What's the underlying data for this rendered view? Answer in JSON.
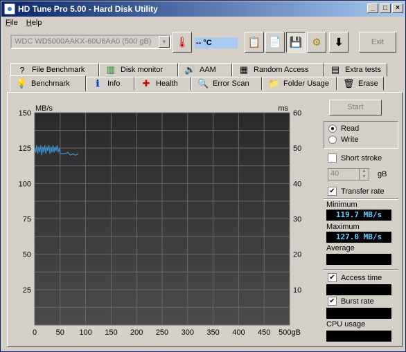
{
  "window": {
    "title": "HD Tune Pro 5.00 - Hard Disk Utility",
    "min": "_",
    "max": "□",
    "close": "×"
  },
  "menu": {
    "file": "File",
    "help": "Help"
  },
  "toolbar": {
    "drive": "WDC WD5000AAKX-60U6AA0 (500 gB)",
    "temperature": "-- °C",
    "exit": "Exit"
  },
  "tabs_top": [
    {
      "label": "File Benchmark",
      "icon": "?"
    },
    {
      "label": "Disk monitor",
      "icon": "▥"
    },
    {
      "label": "AAM",
      "icon": "🔊"
    },
    {
      "label": "Random Access",
      "icon": "▦"
    },
    {
      "label": "Extra tests",
      "icon": "▤"
    }
  ],
  "tabs_bottom": [
    {
      "label": "Benchmark",
      "icon": "💡"
    },
    {
      "label": "Info",
      "icon": "ℹ"
    },
    {
      "label": "Health",
      "icon": "✚"
    },
    {
      "label": "Error Scan",
      "icon": "🔍"
    },
    {
      "label": "Folder Usage",
      "icon": "📁"
    },
    {
      "label": "Erase",
      "icon": "🗑"
    }
  ],
  "right": {
    "start": "Start",
    "read": "Read",
    "write": "Write",
    "short_stroke": "Short stroke",
    "stroke_value": "40",
    "gb": "gB",
    "transfer_rate": "Transfer rate",
    "minimum_label": "Minimum",
    "minimum_value": "119.7 MB/s",
    "maximum_label": "Maximum",
    "maximum_value": "127.0 MB/s",
    "average_label": "Average",
    "average_value": "",
    "access_time": "Access time",
    "access_value": "",
    "burst_rate": "Burst rate",
    "burst_value": "",
    "cpu_usage": "CPU usage",
    "cpu_value": ""
  },
  "chart_data": {
    "type": "line",
    "ylabel": "MB/s",
    "y2label": "ms",
    "ylim": [
      0,
      150
    ],
    "y2lim": [
      0,
      60
    ],
    "xlim": [
      0,
      500
    ],
    "x_ticks": [
      "0",
      "50",
      "100",
      "150",
      "200",
      "250",
      "300",
      "350",
      "400",
      "450",
      "500gB"
    ],
    "y_ticks": [
      "25",
      "50",
      "75",
      "100",
      "125",
      "150"
    ],
    "y2_ticks": [
      "10",
      "20",
      "30",
      "40",
      "50",
      "60"
    ],
    "grid": true,
    "series": [
      {
        "color": "#3a8fd0",
        "x": [
          0,
          2,
          4,
          6,
          8,
          10,
          12,
          14,
          16,
          18,
          20,
          22,
          24,
          26,
          28,
          30,
          32,
          34,
          36,
          38,
          40,
          42,
          44,
          46,
          48,
          50,
          55,
          60,
          65,
          70,
          75,
          80,
          85
        ],
        "y": [
          125,
          122,
          127,
          121,
          126,
          122,
          127,
          120,
          126,
          122,
          127,
          121,
          126,
          123,
          127,
          121,
          126,
          122,
          127,
          122,
          126,
          123,
          127,
          122,
          125,
          121,
          121,
          121,
          122,
          120,
          121,
          120,
          121
        ]
      }
    ]
  }
}
